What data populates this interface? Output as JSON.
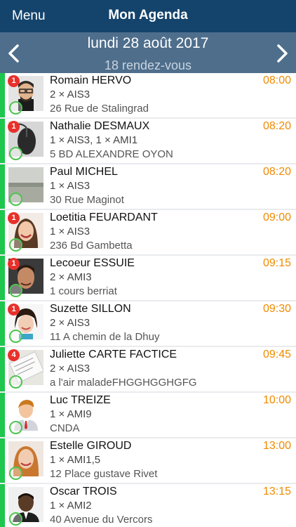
{
  "header": {
    "menu_label": "Menu",
    "title": "Mon Agenda"
  },
  "date_bar": {
    "date": "lundi 28 août 2017",
    "count": "18 rendez-vous"
  },
  "colors": {
    "header_bg": "#14446c",
    "date_bar_bg": "#4e6e8c",
    "status_green": "#1fc64e",
    "time_orange": "#f08a00",
    "badge_red": "#e8302a"
  },
  "appointments": [
    {
      "badge": "1",
      "name": "Romain HERVO",
      "detail": "2 × AIS3",
      "address": "26 Rue de Stalingrad",
      "time": "08:00",
      "avatar": "man-glasses-photo"
    },
    {
      "badge": "1",
      "name": "Nathalie DESMAUX",
      "detail": "1 × AIS3, 1 × AMI1",
      "address": "5 BD ALEXANDRE OYON",
      "time": "08:20",
      "avatar": "mouse-photo"
    },
    {
      "badge": "",
      "name": "Paul MICHEL",
      "detail": "1 × AIS3",
      "address": "30 Rue Maginot",
      "time": "08:20",
      "avatar": "desk-photo"
    },
    {
      "badge": "1",
      "name": "Loetitia FEUARDANT",
      "detail": "1 × AIS3",
      "address": "236 Bd Gambetta",
      "time": "09:00",
      "avatar": "woman-smiling-photo"
    },
    {
      "badge": "1",
      "name": "Lecoeur ESSUIE",
      "detail": "2 × AMI3",
      "address": "1 cours berriat",
      "time": "09:15",
      "avatar": "man-photo"
    },
    {
      "badge": "1",
      "name": "Suzette SILLON",
      "detail": "2 × AIS3",
      "address": "11 A chemin de la Dhuy",
      "time": "09:30",
      "avatar": "woman-photo"
    },
    {
      "badge": "4",
      "name": "Juliette CARTE FACTICE",
      "detail": "2 × AIS3",
      "address": "a l'air maladeFHGGHGGHGFG",
      "time": "09:45",
      "avatar": "document-photo"
    },
    {
      "badge": "",
      "name": "Luc TREIZE",
      "detail": "1 × AMI9",
      "address": "CNDA",
      "time": "10:00",
      "avatar": "person-illustration"
    },
    {
      "badge": "",
      "name": "Estelle GIROUD",
      "detail": "1 × AMI1,5",
      "address": "12 Place gustave Rivet",
      "time": "13:00",
      "avatar": "woman-redhair-photo"
    },
    {
      "badge": "",
      "name": "Oscar TROIS",
      "detail": "1 × AMI2",
      "address": "40 Avenue du Vercors",
      "time": "13:15",
      "avatar": "man-suit-photo"
    }
  ]
}
